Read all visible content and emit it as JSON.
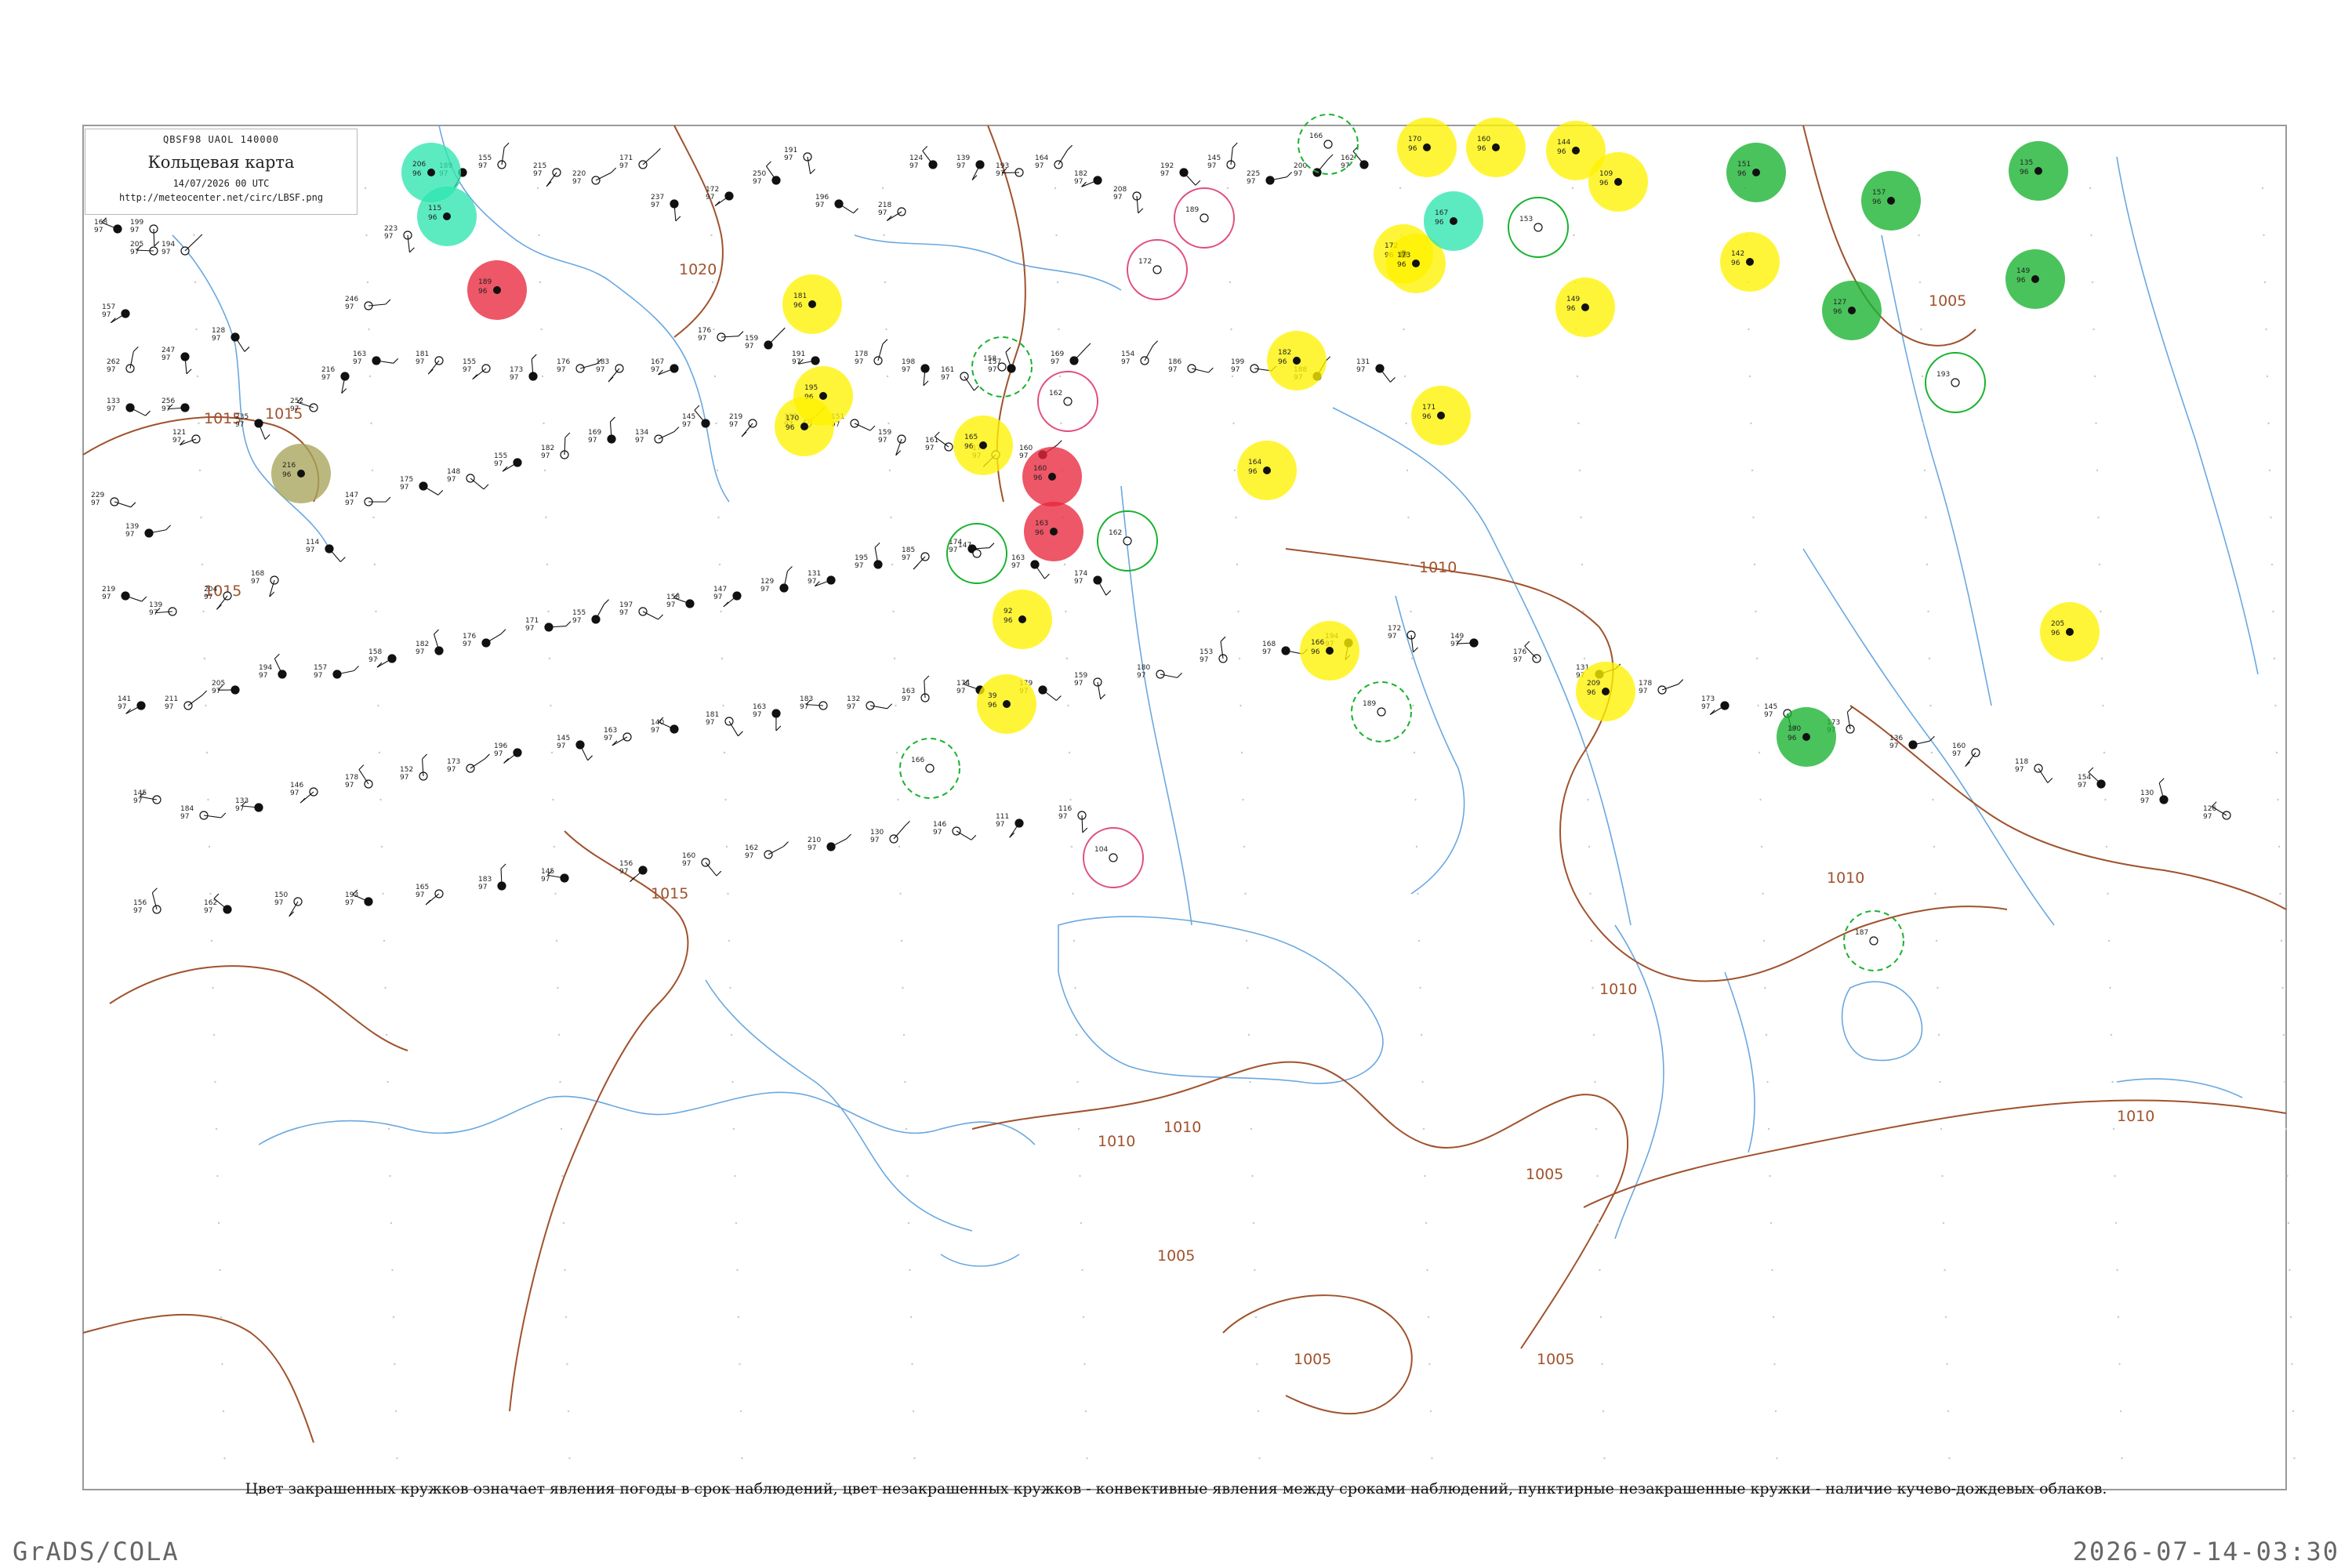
{
  "header": {
    "codes": "QBSF98  UAOL  140000",
    "title": "Кольцевая карта",
    "datetime": "14/07/2026 00 UTC",
    "url": "http://meteocenter.net/circ/LBSF.png"
  },
  "caption": "Цвет закрашенных кружков означает явления погоды в срок наблюдений, цвет незакрашенных кружков - конвективные явления между сроками наблюдений, пунктирные незакрашенные кружки - наличие кучево-дождевых облаков.",
  "footer": {
    "left": "GrADS/COLA",
    "right": "2026-07-14-03:30"
  },
  "colors": {
    "frame": "#9a9a9a",
    "isobar": "#a0522d",
    "water": "#6aa8e0",
    "yellow": "#fff200",
    "green": "#17b22e",
    "red": "#e8283c",
    "aqua": "#2ee6b0",
    "olive": "#a6a45a",
    "pink_ring": "#e0507a"
  },
  "isobar_labels": [
    "1020",
    "1015",
    "1015",
    "1010",
    "1015",
    "1010",
    "1010",
    "1005",
    "1005",
    "1005",
    "1010",
    "1005",
    "1005",
    "1010",
    "1010",
    "1015"
  ],
  "highlight_stations": [
    {
      "kind": "yellow",
      "num": "195"
    },
    {
      "kind": "yellow",
      "num": "181"
    },
    {
      "kind": "yellow",
      "num": "165"
    },
    {
      "kind": "yellow",
      "num": "92"
    },
    {
      "kind": "yellow",
      "num": "39"
    },
    {
      "kind": "yellow",
      "num": "170"
    },
    {
      "kind": "yellow",
      "num": "172"
    },
    {
      "kind": "yellow",
      "num": "160"
    },
    {
      "kind": "yellow",
      "num": "144"
    },
    {
      "kind": "yellow",
      "num": "109"
    },
    {
      "kind": "yellow",
      "num": "173"
    },
    {
      "kind": "yellow",
      "num": "149"
    },
    {
      "kind": "yellow",
      "num": "142"
    },
    {
      "kind": "yellow",
      "num": "166"
    },
    {
      "kind": "yellow",
      "num": "164"
    },
    {
      "kind": "yellow",
      "num": "209"
    },
    {
      "kind": "yellow",
      "num": "205"
    },
    {
      "kind": "yellow",
      "num": "171"
    },
    {
      "kind": "yellow",
      "num": "182"
    },
    {
      "kind": "yellow",
      "num": "170"
    },
    {
      "kind": "green",
      "num": "151"
    },
    {
      "kind": "green",
      "num": "157"
    },
    {
      "kind": "green",
      "num": "127"
    },
    {
      "kind": "green",
      "num": "190"
    },
    {
      "kind": "green",
      "num": "149"
    },
    {
      "kind": "green",
      "num": "135"
    },
    {
      "kind": "red",
      "num": "189"
    },
    {
      "kind": "red",
      "num": "160"
    },
    {
      "kind": "red",
      "num": "163"
    },
    {
      "kind": "aqua",
      "num": "206"
    },
    {
      "kind": "aqua",
      "num": "115"
    },
    {
      "kind": "aqua",
      "num": "167"
    },
    {
      "kind": "olive",
      "num": "216"
    }
  ],
  "ring_stations": [
    {
      "kind": "green-dash",
      "num": "158"
    },
    {
      "kind": "green-dash",
      "num": "189"
    },
    {
      "kind": "green-dash",
      "num": "166"
    },
    {
      "kind": "green-dash",
      "num": "187"
    },
    {
      "kind": "green-dash",
      "num": "166"
    },
    {
      "kind": "pink",
      "num": "162"
    },
    {
      "kind": "pink",
      "num": "172"
    },
    {
      "kind": "pink",
      "num": "189"
    },
    {
      "kind": "pink",
      "num": "104"
    },
    {
      "kind": "green",
      "num": "147"
    },
    {
      "kind": "green",
      "num": "162"
    },
    {
      "kind": "green",
      "num": "193"
    },
    {
      "kind": "green",
      "num": "153"
    }
  ],
  "station_numbers": [
    "168",
    "199",
    "205",
    "194",
    "157",
    "262",
    "133",
    "247",
    "128",
    "256",
    "229",
    "139",
    "121",
    "235",
    "252",
    "216",
    "246",
    "223",
    "189",
    "155",
    "215",
    "220",
    "171",
    "237",
    "172",
    "250",
    "191",
    "196",
    "218",
    "124",
    "139",
    "193",
    "164",
    "182",
    "208",
    "192",
    "145",
    "225",
    "200",
    "162",
    "163",
    "181",
    "155",
    "173",
    "176",
    "183",
    "167",
    "176",
    "159",
    "191",
    "178",
    "198",
    "161",
    "157",
    "169",
    "154",
    "186",
    "199",
    "188",
    "131",
    "219",
    "139",
    "204",
    "168",
    "114",
    "147",
    "175",
    "148",
    "155",
    "182",
    "169",
    "134",
    "145",
    "219",
    "152",
    "151",
    "159",
    "161",
    "174",
    "160",
    "141",
    "211",
    "205",
    "194",
    "157",
    "158",
    "182",
    "176",
    "171",
    "155",
    "197",
    "158",
    "147",
    "129",
    "131",
    "195",
    "185",
    "174",
    "163",
    "174",
    "145",
    "184",
    "133",
    "146",
    "178",
    "152",
    "173",
    "196",
    "145",
    "163",
    "140",
    "181",
    "163",
    "183",
    "132",
    "163",
    "174",
    "179",
    "159",
    "180",
    "153",
    "168",
    "194",
    "172",
    "149",
    "176",
    "131",
    "178",
    "173",
    "145",
    "173",
    "136",
    "160",
    "118",
    "154",
    "130",
    "126",
    "156",
    "162",
    "150",
    "193",
    "165",
    "183",
    "145",
    "156",
    "160",
    "162",
    "210",
    "130",
    "146",
    "111",
    "116"
  ]
}
